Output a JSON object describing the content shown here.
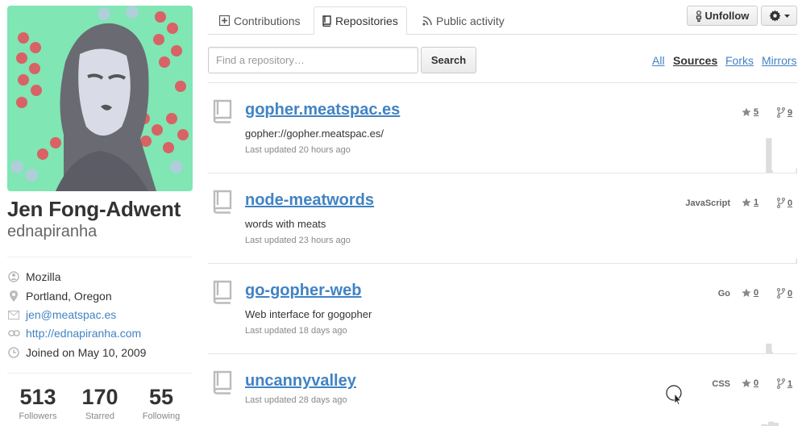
{
  "profile": {
    "full_name": "Jen Fong-Adwent",
    "username": "ednapiranha",
    "details": [
      {
        "icon": "organization-icon",
        "text": "Mozilla",
        "link": false
      },
      {
        "icon": "location-icon",
        "text": "Portland, Oregon",
        "link": false
      },
      {
        "icon": "mail-icon",
        "text": "jen@meatspac.es",
        "link": true
      },
      {
        "icon": "link-icon",
        "text": "http://ednapiranha.com",
        "link": true
      },
      {
        "icon": "clock-icon",
        "text": "Joined on May 10, 2009",
        "link": false
      }
    ],
    "stats": [
      {
        "value": "513",
        "label": "Followers"
      },
      {
        "value": "170",
        "label": "Starred"
      },
      {
        "value": "55",
        "label": "Following"
      }
    ]
  },
  "tabs": [
    {
      "label": "Contributions",
      "icon": "contributions-icon",
      "selected": false
    },
    {
      "label": "Repositories",
      "icon": "repo-icon",
      "selected": true
    },
    {
      "label": "Public activity",
      "icon": "rss-icon",
      "selected": false
    }
  ],
  "actions": {
    "unfollow_label": "Unfollow",
    "settings_icon": "gear-icon"
  },
  "search": {
    "placeholder": "Find a repository…",
    "button_label": "Search"
  },
  "filters": [
    {
      "label": "All",
      "active": false
    },
    {
      "label": "Sources",
      "active": true
    },
    {
      "label": "Forks",
      "active": false
    },
    {
      "label": "Mirrors",
      "active": false
    }
  ],
  "repositories": [
    {
      "name": "gopher.meatspac.es",
      "description": "gopher://gopher.meatspac.es/",
      "updated": "Last updated 20 hours ago",
      "language": "",
      "stars": "5",
      "forks": "9",
      "activity": [
        0,
        0,
        0,
        0,
        0,
        0,
        0,
        0,
        0,
        0,
        0,
        0,
        0,
        0,
        0,
        0,
        0,
        0,
        0,
        0,
        0,
        0,
        0,
        0,
        0,
        0,
        0.95,
        0.06,
        0,
        0,
        0,
        0,
        0,
        0,
        0,
        0,
        0,
        0,
        0,
        0,
        0,
        0,
        0,
        0,
        0,
        0,
        0,
        0,
        0,
        0,
        0,
        0,
        0.12
      ]
    },
    {
      "name": "node-meatwords",
      "description": "words with meats",
      "updated": "Last updated 23 hours ago",
      "language": "JavaScript",
      "stars": "1",
      "forks": "0",
      "activity": [
        0,
        0,
        0,
        0,
        0,
        0,
        0,
        0,
        0,
        0,
        0,
        0,
        0,
        0,
        0,
        0,
        0,
        0,
        0,
        0,
        0,
        0,
        0,
        0,
        0,
        0,
        0,
        0,
        0,
        0,
        0,
        0,
        0,
        0,
        0,
        0,
        0,
        0,
        0,
        0,
        0,
        0,
        0,
        0,
        0,
        0,
        0,
        0,
        0,
        0,
        0,
        0,
        0.12
      ]
    },
    {
      "name": "go-gopher-web",
      "description": "Web interface for gogopher",
      "updated": "Last updated 18 days ago",
      "language": "Go",
      "stars": "0",
      "forks": "0",
      "activity": [
        0,
        0,
        0,
        0,
        0,
        0,
        0,
        0,
        0,
        0,
        0,
        0,
        0,
        0,
        0,
        0,
        0,
        0,
        0,
        0,
        0,
        0,
        0,
        0,
        0,
        0,
        0.27,
        0.05,
        0,
        0,
        0,
        0,
        0,
        0,
        0,
        0,
        0,
        0,
        0,
        0,
        0,
        0,
        0,
        0,
        0,
        0,
        0,
        0,
        0,
        0,
        0,
        0,
        0
      ]
    },
    {
      "name": "uncannyvalley",
      "description": "",
      "updated": "Last updated 28 days ago",
      "language": "CSS",
      "stars": "0",
      "forks": "1",
      "activity": [
        0,
        0,
        0,
        0,
        0,
        0,
        0,
        0,
        0,
        0,
        0,
        0,
        0,
        0,
        0,
        0,
        0,
        0,
        0,
        0,
        0,
        0,
        0.05,
        0,
        0,
        0,
        0.03,
        0,
        0.12,
        0,
        0.05,
        0,
        0.09,
        0,
        0,
        0,
        0,
        0,
        0,
        0,
        0,
        0,
        0,
        0,
        0,
        0,
        0,
        0,
        0,
        0,
        0,
        0,
        0
      ]
    }
  ],
  "colors": {
    "link": "#4183c4",
    "text": "#333333",
    "muted": "#888888",
    "spark": "#dddddd"
  }
}
